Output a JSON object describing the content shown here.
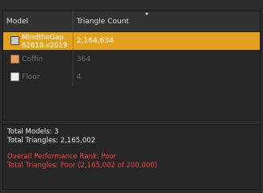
{
  "table": {
    "columns": [
      "Model",
      "Triangle Count"
    ],
    "rows": [
      {
        "name_line1": "MIndtheGap.",
        "name_line2": "62618.v2019",
        "triangles": "2,164,634",
        "selected": true
      },
      {
        "name": "Coffin",
        "triangles": "364",
        "color": "#e89d5a"
      },
      {
        "name": "Floor",
        "triangles": "4",
        "color": "#ededed"
      }
    ]
  },
  "stats": {
    "total_models": "Total Models: 3",
    "total_triangles": "Total Triangles: 2,165,002",
    "performance_rank": "Overall Performance Rank: Poor",
    "triangles_rank": "Total Triangles: Poor (2,165,002 of 200,000)"
  },
  "colors": {
    "selection": "#e2a11e",
    "warning": "#ff3a3a",
    "background": "#2b2b2b"
  }
}
